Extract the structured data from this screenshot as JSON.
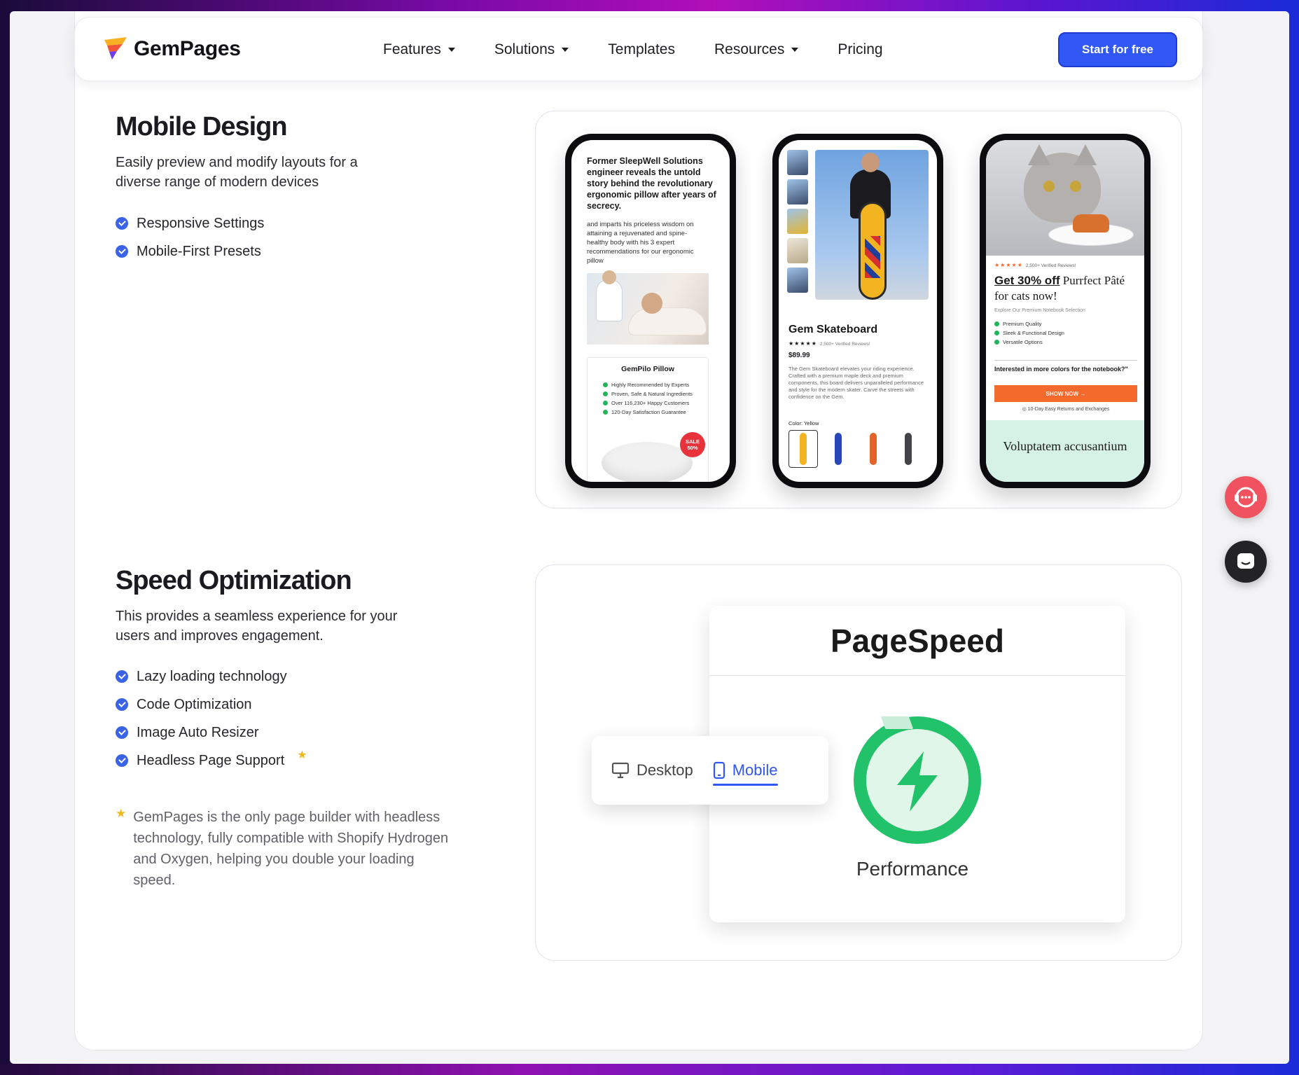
{
  "nav": {
    "brand": "GemPages",
    "menu": [
      {
        "label": "Features",
        "has_dropdown": true
      },
      {
        "label": "Solutions",
        "has_dropdown": true
      },
      {
        "label": "Templates",
        "has_dropdown": false
      },
      {
        "label": "Resources",
        "has_dropdown": true
      },
      {
        "label": "Pricing",
        "has_dropdown": false
      }
    ],
    "cta_label": "Start for free"
  },
  "mobile_design": {
    "title": "Mobile Design",
    "description": "Easily preview and modify layouts for a diverse range of modern devices",
    "bullets": [
      "Responsive Settings",
      "Mobile-First Presets"
    ],
    "phones": {
      "pillow": {
        "headline": "Former SleepWell Solutions engineer reveals the untold story behind the revolutionary ergonomic pillow after years of secrecy.",
        "body": "and imparts his priceless wisdom on attaining a rejuvenated and spine-healthy body with his 3 expert recommendations for our ergonomic pillow",
        "product_name": "GemPilo Pillow",
        "features": [
          "Highly Recommended by Experts",
          "Proven, Safe & Natural Ingredients",
          "Over 116,230+ Happy Customers",
          "120-Day Satisfaction Guarantee"
        ],
        "sale_badge": "SALE 50%"
      },
      "skateboard": {
        "product_name": "Gem Skateboard",
        "stars": "★★★★★",
        "reviews": "2,500+ Verified Reviews!",
        "price": "$89.99",
        "description": "The Gem Skateboard elevates your riding experience. Crafted with a premium maple deck and premium components, this board delivers unparalleled performance and style for the modern skater. Carve the streets with confidence on the Gem.",
        "color_label": "Color: Yellow",
        "swatch_colors": [
          "#f2b521",
          "#2a47b8",
          "#e2642a",
          "#444448"
        ]
      },
      "cat": {
        "stars": "★★★★★",
        "reviews": "2,500+ Verified Reviews!",
        "title_bold": "Get 30% off",
        "title_rest": " Purrfect Pâté for cats now!",
        "subtitle": "Explore Our Premium Notebook Selection",
        "features": [
          "Premium Quality",
          "Sleek & Functional Design",
          "Versatile Options"
        ],
        "question": "Interested in more colors for the notebook?\"",
        "shop_label": "SHOW NOW →",
        "returns": "10-Day Easy Returns and Exchanges",
        "footer_text": "Voluptatem accusantium"
      }
    }
  },
  "speed": {
    "title": "Speed Optimization",
    "description": "This provides a seamless experience for your users and improves engagement.",
    "bullets": [
      "Lazy loading technology",
      "Code Optimization",
      "Image Auto Resizer",
      "Headless Page Support"
    ],
    "note": "GemPages is the only page builder with headless technology, fully compatible with Shopify Hydrogen and Oxygen, helping you double your loading speed.",
    "pagespeed": {
      "title": "PageSpeed",
      "metric": "Performance",
      "tabs": [
        {
          "label": "Desktop",
          "active": false
        },
        {
          "label": "Mobile",
          "active": true
        }
      ]
    }
  },
  "colors": {
    "accent": "#3157f5",
    "check": "#3a63e8",
    "star": "#f0b91a",
    "performance_green": "#22c26a"
  }
}
